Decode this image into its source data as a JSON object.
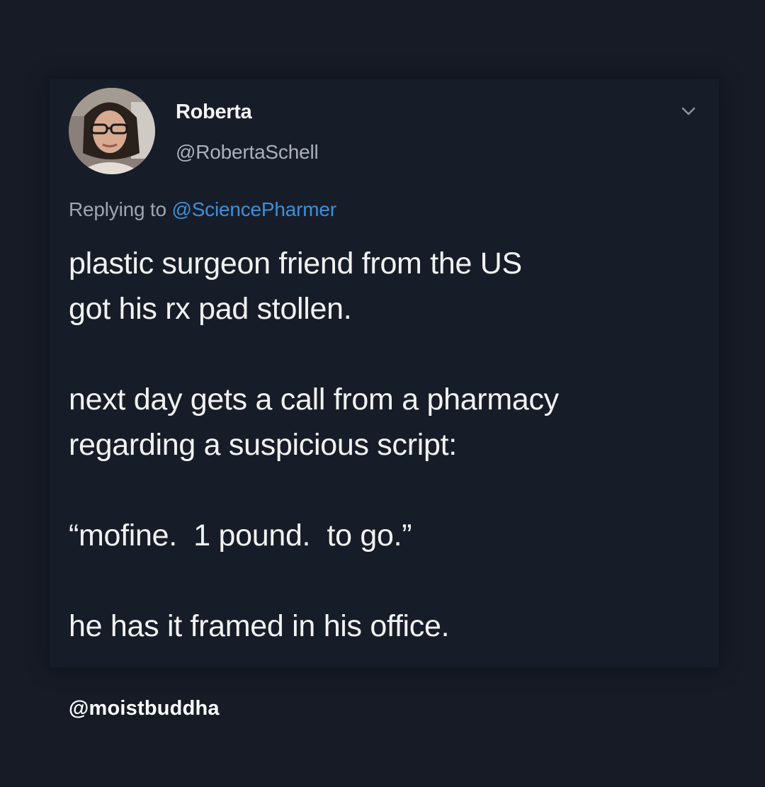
{
  "tweet": {
    "author": {
      "display_name": "Roberta",
      "handle": "@RobertaSchell"
    },
    "reply": {
      "prefix": "Replying to",
      "mention": "@SciencePharmer"
    },
    "paragraphs": [
      {
        "line1": "plastic surgeon friend from the US",
        "line2": "got his rx pad stollen."
      },
      {
        "line1": "next day gets a call from a pharmacy",
        "line2": "regarding a suspicious script:"
      },
      {
        "line1": "“mofine.  1 pound.  to go.”"
      },
      {
        "line1": "he has it framed in his office."
      }
    ],
    "menu_icon": "chevron-down-icon"
  },
  "watermark": "@moistbuddha",
  "colors": {
    "background": "#161b26",
    "text": "#f2f2f2",
    "secondary_text": "#aab1bc",
    "link": "#3f8fd8"
  }
}
